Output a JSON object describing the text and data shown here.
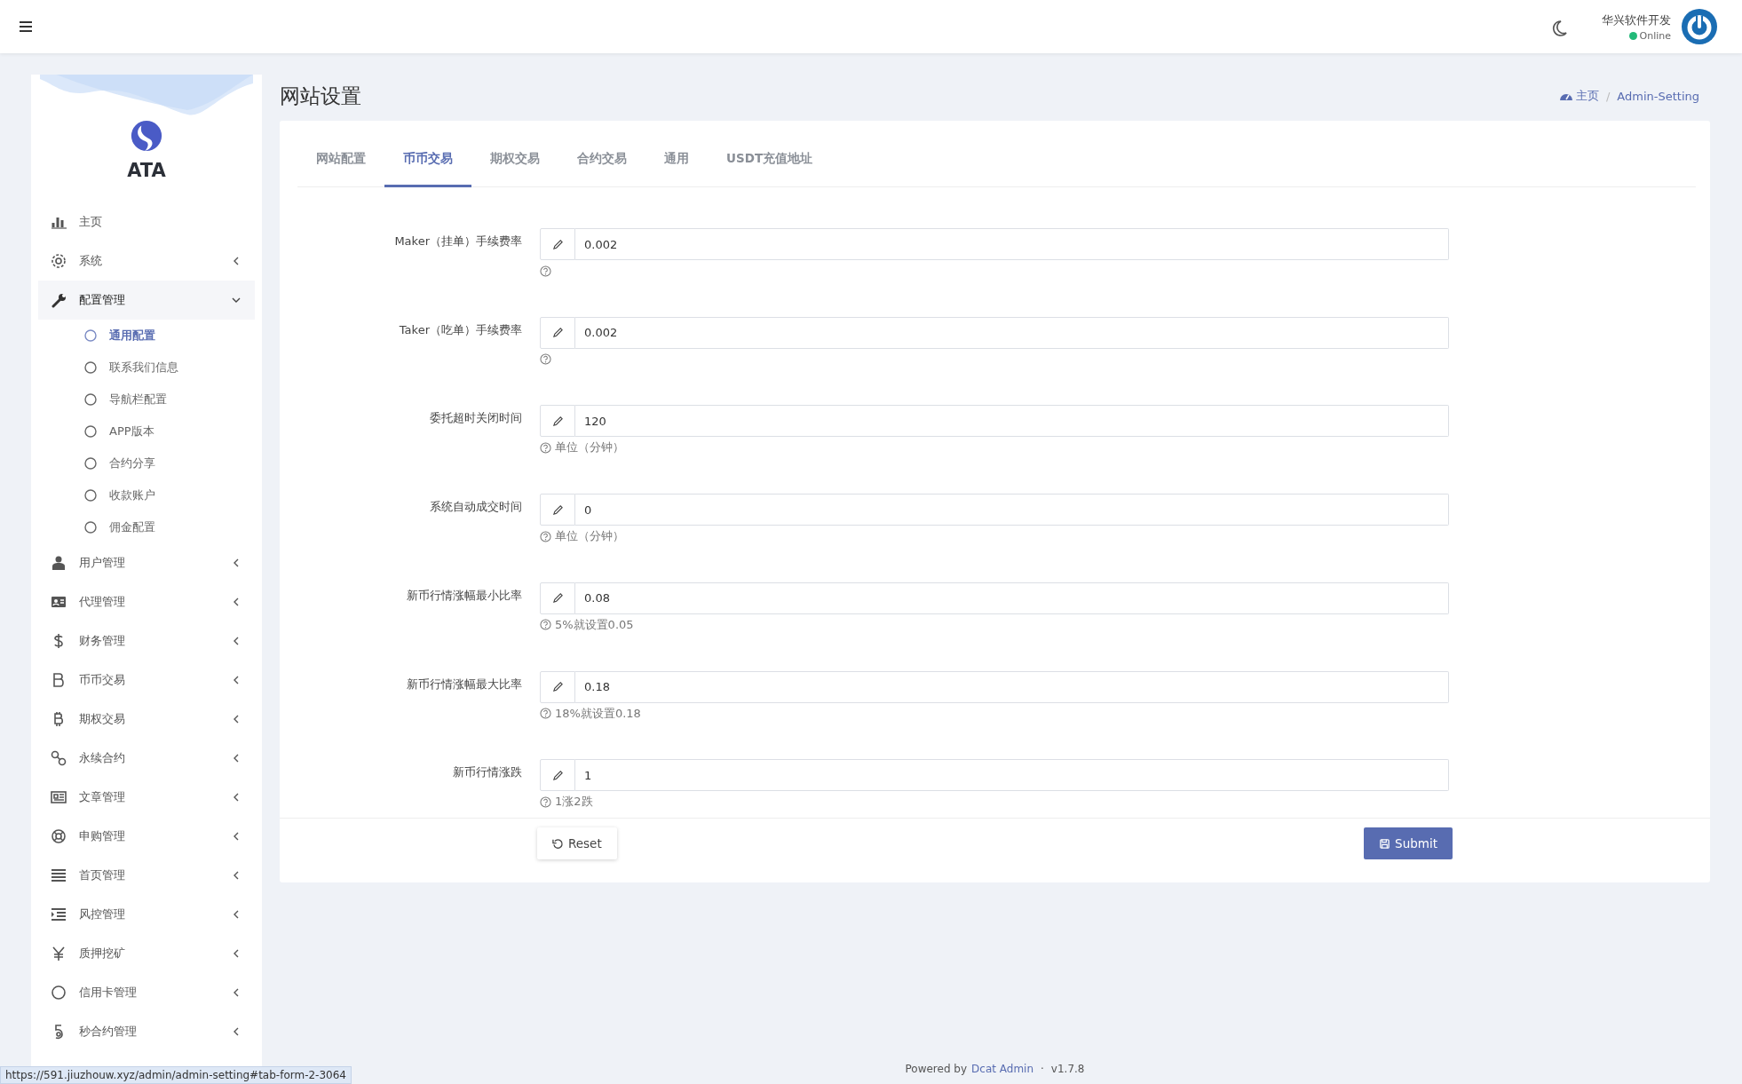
{
  "header": {
    "user_name": "华兴软件开发",
    "status": "Online"
  },
  "sidebar": {
    "brand": "ATA",
    "items": [
      {
        "label": "主页",
        "kind": "link"
      },
      {
        "label": "系统",
        "kind": "group",
        "expanded": false
      },
      {
        "label": "配置管理",
        "kind": "group",
        "expanded": true,
        "children": [
          {
            "label": "通用配置",
            "selected": true
          },
          {
            "label": "联系我们信息",
            "selected": false
          },
          {
            "label": "导航栏配置",
            "selected": false
          },
          {
            "label": "APP版本",
            "selected": false
          },
          {
            "label": "合约分享",
            "selected": false
          },
          {
            "label": "收款账户",
            "selected": false
          },
          {
            "label": "佣金配置",
            "selected": false
          }
        ]
      },
      {
        "label": "用户管理",
        "kind": "group",
        "expanded": false
      },
      {
        "label": "代理管理",
        "kind": "group",
        "expanded": false
      },
      {
        "label": "财务管理",
        "kind": "group",
        "expanded": false
      },
      {
        "label": "币币交易",
        "kind": "group",
        "expanded": false
      },
      {
        "label": "期权交易",
        "kind": "group",
        "expanded": false
      },
      {
        "label": "永续合约",
        "kind": "group",
        "expanded": false
      },
      {
        "label": "文章管理",
        "kind": "group",
        "expanded": false
      },
      {
        "label": "申购管理",
        "kind": "group",
        "expanded": false
      },
      {
        "label": "首页管理",
        "kind": "group",
        "expanded": false
      },
      {
        "label": "风控管理",
        "kind": "group",
        "expanded": false
      },
      {
        "label": "质押挖矿",
        "kind": "group",
        "expanded": false
      },
      {
        "label": "信用卡管理",
        "kind": "group",
        "expanded": false
      },
      {
        "label": "秒合约管理",
        "kind": "group",
        "expanded": false
      }
    ]
  },
  "page": {
    "title": "网站设置",
    "breadcrumb": {
      "home": "主页",
      "separator": "/",
      "current": "Admin-Setting"
    }
  },
  "tabs": [
    {
      "label": "网站配置",
      "selected": false
    },
    {
      "label": "币币交易",
      "selected": true
    },
    {
      "label": "期权交易",
      "selected": false
    },
    {
      "label": "合约交易",
      "selected": false
    },
    {
      "label": "通用",
      "selected": false
    },
    {
      "label": "USDT充值地址",
      "selected": false
    }
  ],
  "form": {
    "fields": [
      {
        "label": "Maker（挂单）手续费率",
        "value": "0.002"
      },
      {
        "label": "Taker（吃单）手续费率",
        "value": "0.002"
      },
      {
        "label": "委托超时关闭时间",
        "value": "120",
        "help": "单位（分钟）"
      },
      {
        "label": "系统自动成交时间",
        "value": "0",
        "help": "单位（分钟）"
      },
      {
        "label": "新币行情涨幅最小比率",
        "value": "0.08",
        "help": "5%就设置0.05"
      },
      {
        "label": "新币行情涨幅最大比率",
        "value": "0.18",
        "help": "18%就设置0.18"
      },
      {
        "label": "新币行情涨跌",
        "value": "1",
        "help": "1涨2跌"
      }
    ],
    "reset": "Reset",
    "submit": "Submit"
  },
  "footer": {
    "prefix": "Powered by",
    "link": "Dcat Admin",
    "separator": "·",
    "version": "v1.7.8"
  },
  "status_bar": {
    "url": "https://591.jiuzhouw.xyz/admin/admin-setting#tab-form-2-3064"
  }
}
